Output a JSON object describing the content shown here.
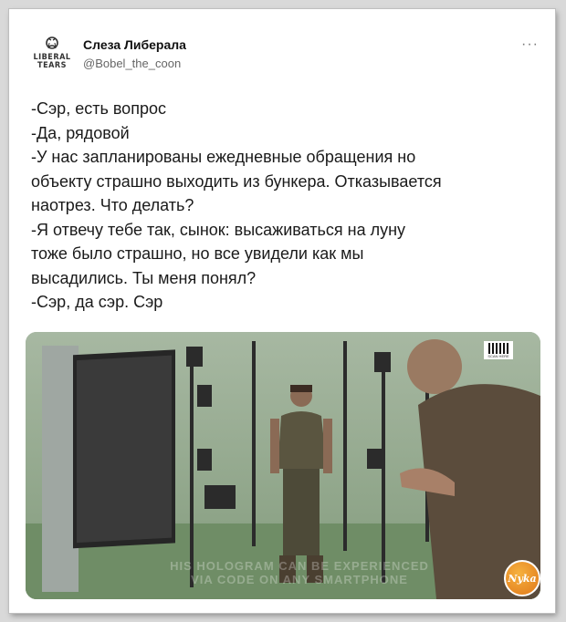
{
  "tweet": {
    "author_name": "Слеза Либерала",
    "author_handle": "@Bobel_the_coon",
    "avatar_logo_text_line1": "LIBERAL",
    "avatar_logo_text_line2": "TEARS",
    "more_icon": "···",
    "lines": [
      "-Сэр, есть вопрос",
      "-Да, рядовой",
      "-У нас запланированы ежедневные обращения но",
      "объекту страшно выходить из бункера. Отказывается",
      "наотрез. Что делать?",
      "-Я отвечу тебе так, сынок: высаживаться на луну",
      "тоже было страшно, но все увидели как мы",
      "высадились. Ты меня понял?",
      "-Сэр, да сэр. Сэр"
    ]
  },
  "photo": {
    "caption_line1": "HIS HOLOGRAM CAN BE EXPERIENCED",
    "caption_line2": "VIA CODE ON ANY SMARTPHONE",
    "qr_label": "SCAN HERE",
    "watermark_text": "Nyka"
  },
  "colors": {
    "background": "#d9d9d9",
    "card": "#ffffff",
    "text": "#1a1a1a",
    "muted": "#666666",
    "studio_green": "#8fa18c",
    "badge": "#e8901f"
  },
  "icons": {
    "avatar": "liberal-tears-logo",
    "more": "more-options-icon",
    "watermark": "site-watermark-badge"
  }
}
